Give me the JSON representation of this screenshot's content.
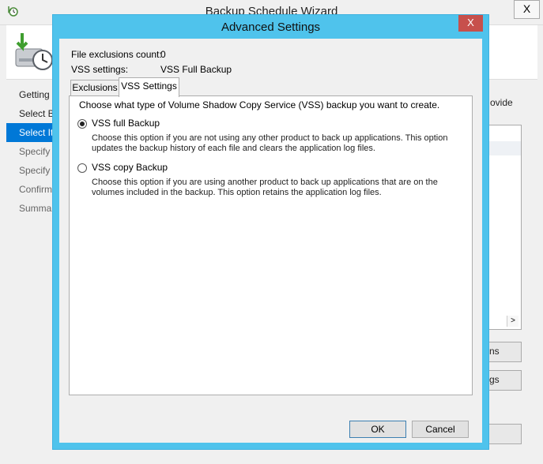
{
  "wizard": {
    "title": "Backup Schedule Wizard",
    "close_glyph": "X",
    "nav": [
      "Getting",
      "Select Ba",
      "Select Ite",
      "Specify I",
      "Specify I",
      "Confirm",
      "Summar"
    ],
    "provide_text": "ovide",
    "buttons": [
      "ns",
      "gs",
      ""
    ]
  },
  "dialog": {
    "title": "Advanced Settings",
    "close_glyph": "X",
    "info": {
      "exclusions_label": "File exclusions count:",
      "exclusions_value": "0",
      "vss_label": "VSS settings:",
      "vss_value": "VSS Full Backup"
    },
    "tabs": [
      "Exclusions",
      "VSS Settings"
    ],
    "vss": {
      "intro": "Choose what type of Volume Shadow Copy Service (VSS) backup you want to create.",
      "full_label": "VSS full Backup",
      "full_desc": "Choose this option if you are not using any other product to back up applications. This option updates the backup history of each file and clears the application log files.",
      "copy_label": "VSS copy Backup",
      "copy_desc": "Choose this option if you are using another product to back up applications that are on the volumes included in the backup. This option retains the application log files.",
      "selected": "full"
    },
    "ok_label": "OK",
    "cancel_label": "Cancel"
  },
  "icons": [
    "wizard-app-icon",
    "backup-clock-icon",
    "chevron-right-icon",
    "close-icon"
  ]
}
